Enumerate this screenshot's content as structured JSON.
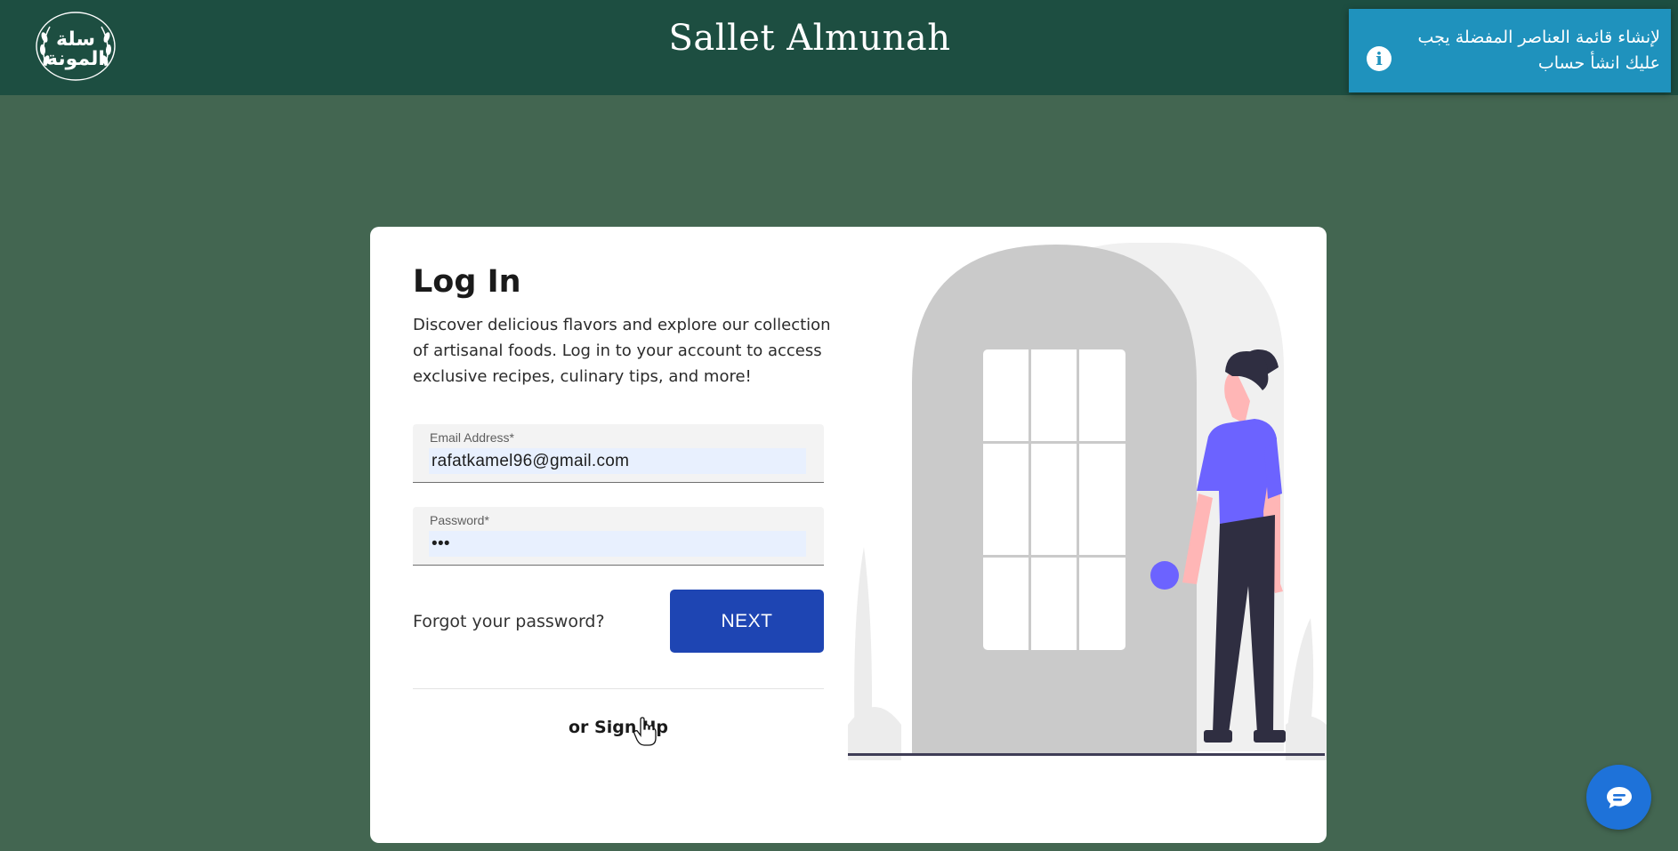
{
  "header": {
    "logo_text": "سلة المونة",
    "site_title": "Sallet Almunah"
  },
  "toast": {
    "icon": "info-icon",
    "message": "لإنشاء قائمة العناصر المفضلة يجب عليك انشأ حساب"
  },
  "login": {
    "title": "Log In",
    "description": "Discover delicious flavors and explore our collection of artisanal foods. Log in to your account to access exclusive recipes, culinary tips, and more!",
    "email_label": "Email Address*",
    "email_value": "rafatkamel96@gmail.com",
    "password_label": "Password*",
    "password_value": "•••",
    "forgot_link": "Forgot your password?",
    "next_button": "NEXT",
    "signup_link": "or Sign Up"
  },
  "chat": {
    "icon": "chat-icon"
  },
  "colors": {
    "header_bg": "#1d4e41",
    "page_bg": "#436651",
    "toast_bg": "#1f92bd",
    "primary_button": "#1e45b3",
    "illustration_accent": "#6c63ff",
    "chat_button": "#1e72d9"
  }
}
